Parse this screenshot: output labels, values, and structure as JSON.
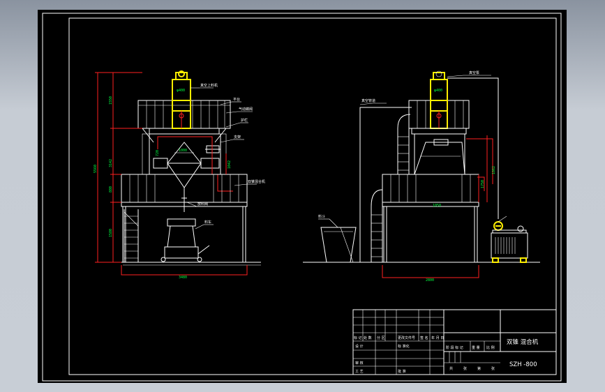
{
  "title_block": {
    "drawing_name": "双锥 混合机",
    "model_number": "SZH -800",
    "row_design_labels": [
      "设 计",
      "标 准化"
    ],
    "row_check_labels": [
      "审 核"
    ],
    "row_process_labels": [
      "工 艺",
      "批 准"
    ],
    "stage_labels": [
      "阶 段 标 记",
      "重 量",
      "比 例"
    ],
    "sheet_labels": [
      "共",
      "张",
      "第",
      "张"
    ],
    "revision_header": [
      "标 记",
      "处 数",
      "分 区",
      "更改文件号",
      "签 名",
      "年 月 日"
    ]
  },
  "dimensions": {
    "left_total_height": "5560",
    "left_top_height": "1550",
    "left_mid_height": "3142",
    "left_low_height": "880",
    "left_base_height": "1580",
    "left_width": "3480",
    "right_width": "2800",
    "right_side_height": "1862",
    "right_side_small": "1750",
    "cone_dia_left": "1000",
    "cone_dia_right": "1050",
    "feeder_dia_left": "φ400",
    "feeder_dia_right": "φ400",
    "small_a": "720",
    "small_b": "1042"
  },
  "callouts": {
    "vacuum_feeder": "真空上料机",
    "platform": "平台",
    "control_valve": "气动蝶阀",
    "rail": "护栏",
    "support": "支架",
    "mixer": "双锥混合机",
    "discharge": "放料阀",
    "cart": "料车",
    "hopper": "料斗",
    "pipe": "真空管道",
    "cabinet": "真空泵"
  }
}
